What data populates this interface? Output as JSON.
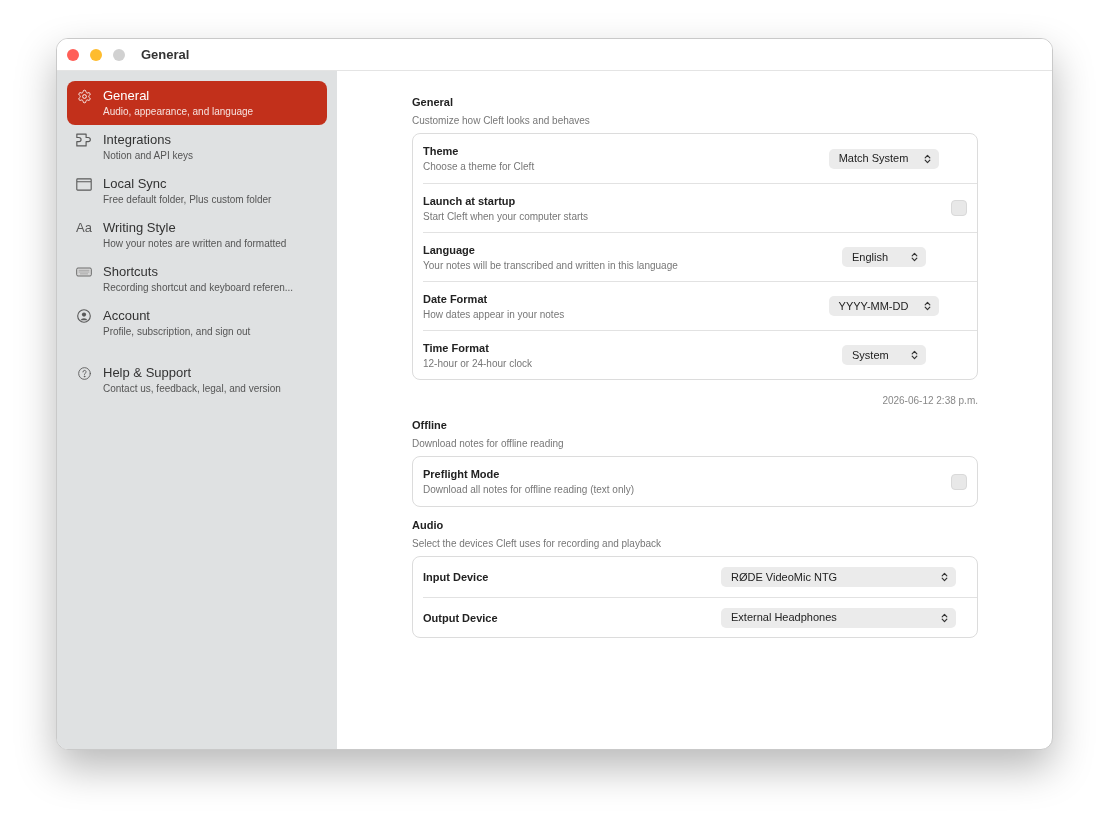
{
  "window": {
    "title": "General",
    "controls": [
      {
        "kind": "close",
        "disabled": false
      },
      {
        "kind": "minimize",
        "disabled": false
      },
      {
        "kind": "zoom",
        "disabled": true
      }
    ]
  },
  "sidebar": {
    "groups": [
      {
        "items": [
          {
            "title": "General",
            "subtitle": "Audio, appearance, and language",
            "selected": true
          },
          {
            "title": "Integrations",
            "subtitle": "Notion and API keys",
            "selected": false
          },
          {
            "title": "Local Sync",
            "subtitle": "Free default folder, Plus custom folder",
            "selected": false
          },
          {
            "glyph": "Aa",
            "title": "Writing Style",
            "subtitle": "How your notes are written and formatted",
            "selected": false
          },
          {
            "title": "Shortcuts",
            "subtitle": "Recording shortcut and keyboard referen...",
            "selected": false
          },
          {
            "title": "Account",
            "subtitle": "Profile, subscription, and sign out",
            "selected": false
          }
        ]
      },
      {
        "items": [
          {
            "title": "Help & Support",
            "subtitle": "Contact us, feedback, legal, and version",
            "selected": false
          }
        ]
      }
    ]
  },
  "sections": [
    {
      "title": "General",
      "subtitle": "Customize how Cleft looks and behaves",
      "rows": [
        {
          "kind": "select",
          "label": "Theme",
          "description": "Choose a theme for Cleft",
          "value": "Match System"
        },
        {
          "kind": "checkbox",
          "label": "Launch at startup",
          "description": "Start Cleft when your computer starts",
          "checked": false
        },
        {
          "kind": "select",
          "label": "Language",
          "description": "Your notes will be transcribed and written in this language",
          "value": "English"
        },
        {
          "kind": "select",
          "label": "Date Format",
          "description": "How dates appear in your notes",
          "value": "YYYY-MM-DD"
        },
        {
          "kind": "select",
          "label": "Time Format",
          "description": "12-hour or 24-hour clock",
          "value": "System"
        }
      ],
      "footer": "2026-06-12 2:38 p.m."
    },
    {
      "title": "Offline",
      "subtitle": "Download notes for offline reading",
      "rows": [
        {
          "kind": "checkbox",
          "label": "Preflight Mode",
          "description": "Download all notes for offline reading (text only)",
          "checked": false
        }
      ]
    },
    {
      "title": "Audio",
      "subtitle": "Select the devices Cleft uses for recording and playback",
      "rows": [
        {
          "kind": "device",
          "label": "Input Device",
          "value": "RØDE VideoMic NTG"
        },
        {
          "kind": "device",
          "label": "Output Device",
          "value": "External Headphones"
        }
      ]
    }
  ]
}
